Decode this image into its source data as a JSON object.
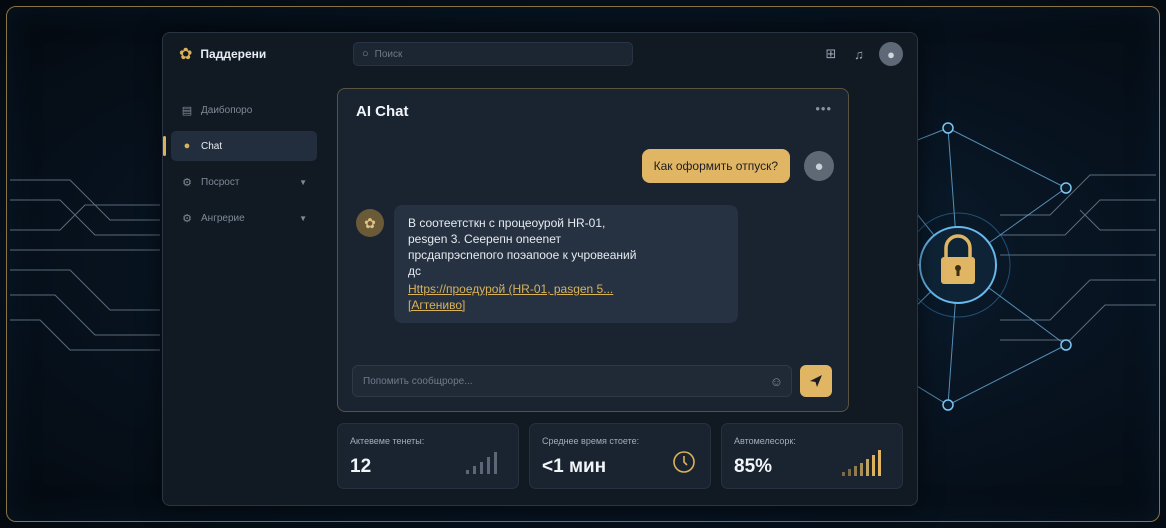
{
  "app": {
    "name": "Паддерени",
    "logo_icon": "gear-flower-icon"
  },
  "search": {
    "placeholder": "Поиск"
  },
  "sidebar": {
    "items": [
      {
        "label": "Даибопоро",
        "icon": "dashboard-icon",
        "active": false
      },
      {
        "label": "Chat",
        "icon": "chat-icon",
        "active": true
      },
      {
        "label": "Посрост",
        "icon": "settings-icon",
        "active": false,
        "expandable": true
      },
      {
        "label": "Ангрерие",
        "icon": "settings-icon",
        "active": false,
        "expandable": true
      }
    ]
  },
  "chat": {
    "title": "AI Chat",
    "user_message": "Как оформить отпуск?",
    "bot_message": {
      "lines": [
        "В соотеетсткн с процеоурой HR-01,",
        "pesgen 3. Сеерепн оnеenет",
        "прсдапрэсnепого поэапоое к учровеаний",
        "дс"
      ],
      "link_line1": "Https://проедурой (HR-01, pasgen 5...",
      "link_line2": "[Агтениво]"
    },
    "composer_placeholder": "Попомить сообщроре..."
  },
  "stats": [
    {
      "label": "Актевеме тенеты:",
      "value": "12"
    },
    {
      "label": "Среднее время стоете:",
      "value": "<1 мин"
    },
    {
      "label": "Автомелесорк:",
      "value": "85%"
    }
  ],
  "colors": {
    "accent": "#e0b665",
    "panel": "#1a2330",
    "background": "#081523"
  }
}
